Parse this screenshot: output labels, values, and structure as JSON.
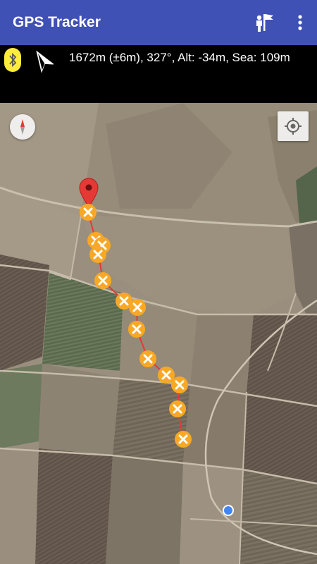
{
  "app": {
    "title": "GPS Tracker"
  },
  "toolbar": {
    "flag_icon": "waypoint-flag-person-icon",
    "overflow_icon": "more-vert-icon"
  },
  "status": {
    "bluetooth_icon": "bluetooth-icon",
    "heading_icon": "navigation-arrow-icon",
    "readout": "1672m (±6m), 327°, Alt: -34m, Sea: 109m"
  },
  "map": {
    "compass_icon": "compass-icon",
    "locate_icon": "my-location-icon",
    "start_marker_icon": "map-pin-icon",
    "waypoint_icon": "waypoint-x-icon",
    "current_location_icon": "blue-dot-icon",
    "colors": {
      "appbar": "#3F51B5",
      "track": "#E53935",
      "waypoint": "#F9A825",
      "pin": "#E53935",
      "current_location": "#4285F4"
    }
  }
}
